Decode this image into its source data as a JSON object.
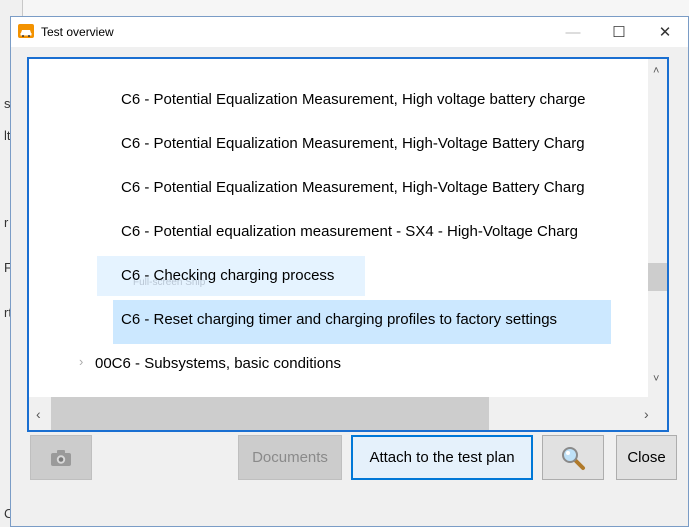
{
  "window": {
    "title": "Test overview",
    "minimize_glyph": "—",
    "maximize_glyph": "☐",
    "close_glyph": "✕"
  },
  "background": {
    "fragments": [
      "s",
      "lt",
      "r",
      "F",
      "rt",
      "C"
    ]
  },
  "tree": {
    "rows": [
      "C6 - Potential Equalization Measurement, High voltage battery charge",
      "C6 - Potential Equalization Measurement, High-Voltage Battery Charg",
      "C6 - Potential Equalization Measurement, High-Voltage Battery Charg",
      "C6 - Potential equalization measurement -  SX4 - High-Voltage Charg",
      "C6 - Checking charging process",
      "C6 - Reset charging timer and charging profiles to factory settings"
    ],
    "collapsed_node": "00C6 - Subsystems, basic conditions",
    "snip_overlay": "Full-screen Snip",
    "expand_glyph": "›",
    "selected_index": 5
  },
  "scrollbars": {
    "up": "˄",
    "down": "˅",
    "left": "‹",
    "right": "›"
  },
  "buttons": {
    "documents": "Documents",
    "attach": "Attach to the test plan",
    "close": "Close"
  },
  "icons": {
    "app": "car-icon",
    "camera": "camera-icon",
    "search": "magnifier-icon"
  },
  "colors": {
    "accent": "#1a6fd1",
    "selection": "#cce8ff"
  }
}
